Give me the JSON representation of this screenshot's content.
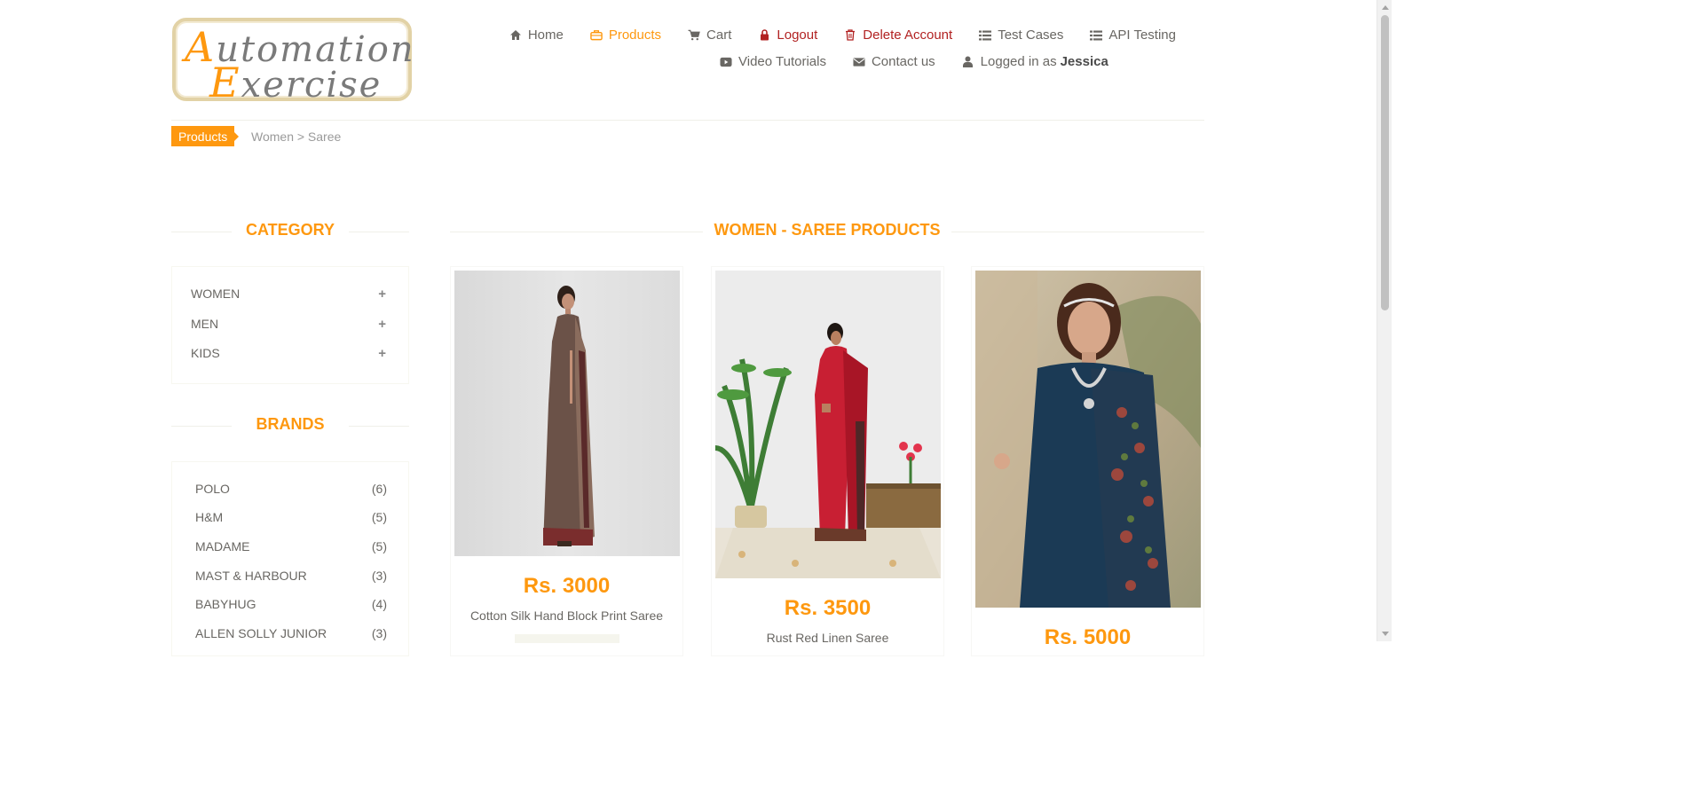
{
  "logo": {
    "line1_cap": "A",
    "line1_rest": "utomation",
    "line2_cap": "E",
    "line2_rest": "xercise"
  },
  "nav": {
    "row1": [
      {
        "label": "Home",
        "icon": "home-icon"
      },
      {
        "label": "Products",
        "icon": "briefcase-icon",
        "active": true
      },
      {
        "label": "Cart",
        "icon": "cart-icon"
      },
      {
        "label": "Logout",
        "icon": "lock-icon"
      },
      {
        "label": "Delete Account",
        "icon": "trash-icon"
      },
      {
        "label": "Test Cases",
        "icon": "list-icon"
      },
      {
        "label": "API Testing",
        "icon": "list-icon"
      }
    ],
    "row2": [
      {
        "label": "Video Tutorials",
        "icon": "youtube-icon"
      },
      {
        "label": "Contact us",
        "icon": "envelope-icon"
      },
      {
        "label": "Logged in as",
        "icon": "user-icon",
        "username": "Jessica"
      }
    ]
  },
  "breadcrumb": {
    "tag": "Products",
    "path": "Women > Saree"
  },
  "sidebar": {
    "category_title": "CATEGORY",
    "categories": [
      {
        "label": "WOMEN",
        "toggle": "+"
      },
      {
        "label": "MEN",
        "toggle": "+"
      },
      {
        "label": "KIDS",
        "toggle": "+"
      }
    ],
    "brands_title": "BRANDS",
    "brands": [
      {
        "label": "POLO",
        "count": "(6)"
      },
      {
        "label": "H&M",
        "count": "(5)"
      },
      {
        "label": "MADAME",
        "count": "(5)"
      },
      {
        "label": "MAST & HARBOUR",
        "count": "(3)"
      },
      {
        "label": "BABYHUG",
        "count": "(4)"
      },
      {
        "label": "ALLEN SOLLY JUNIOR",
        "count": "(3)"
      }
    ]
  },
  "main": {
    "title": "WOMEN - SAREE PRODUCTS",
    "products": [
      {
        "price": "Rs. 3000",
        "name": "Cotton Silk Hand Block Print Saree"
      },
      {
        "price": "Rs. 3500",
        "name": "Rust Red Linen Saree"
      },
      {
        "price": "Rs. 5000",
        "name": ""
      }
    ]
  },
  "colors": {
    "accent": "#FE980F",
    "text": "#696763",
    "danger": "#B22222"
  }
}
